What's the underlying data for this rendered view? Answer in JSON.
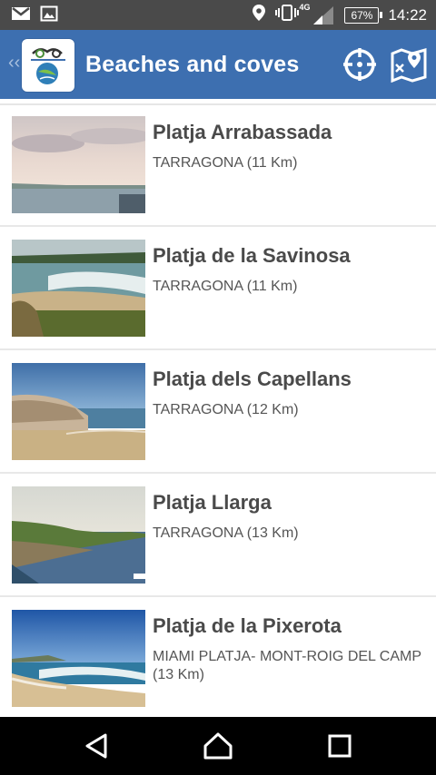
{
  "status_bar": {
    "network": "4G",
    "battery": "67%",
    "time": "14:22",
    "icons": [
      "gmail-icon",
      "gallery-icon",
      "location-icon",
      "vibrate-icon",
      "signal-icon",
      "battery-icon"
    ]
  },
  "app_bar": {
    "title": "Beaches and coves",
    "icons": [
      "back-chevron-icon",
      "app-logo",
      "locate-icon",
      "map-icon"
    ]
  },
  "beaches": [
    {
      "name": "Platja Arrabassada",
      "location": "TARRAGONA  (11 Km)"
    },
    {
      "name": "Platja de la Savinosa",
      "location": "TARRAGONA  (11 Km)"
    },
    {
      "name": "Platja dels Capellans",
      "location": "TARRAGONA  (12 Km)"
    },
    {
      "name": "Platja Llarga",
      "location": "TARRAGONA  (13 Km)"
    },
    {
      "name": "Platja de la Pixerota",
      "location": "MIAMI PLATJA- MONT-ROIG DEL CAMP (13 Km)"
    }
  ],
  "colors": {
    "app_bar": "#3d6fb0",
    "status_bar": "#4a4a4a",
    "title_text": "#4a4a4a",
    "nav_bar": "#000000"
  },
  "nav_bar": {
    "icons": [
      "back-icon",
      "home-icon",
      "recents-icon"
    ]
  }
}
